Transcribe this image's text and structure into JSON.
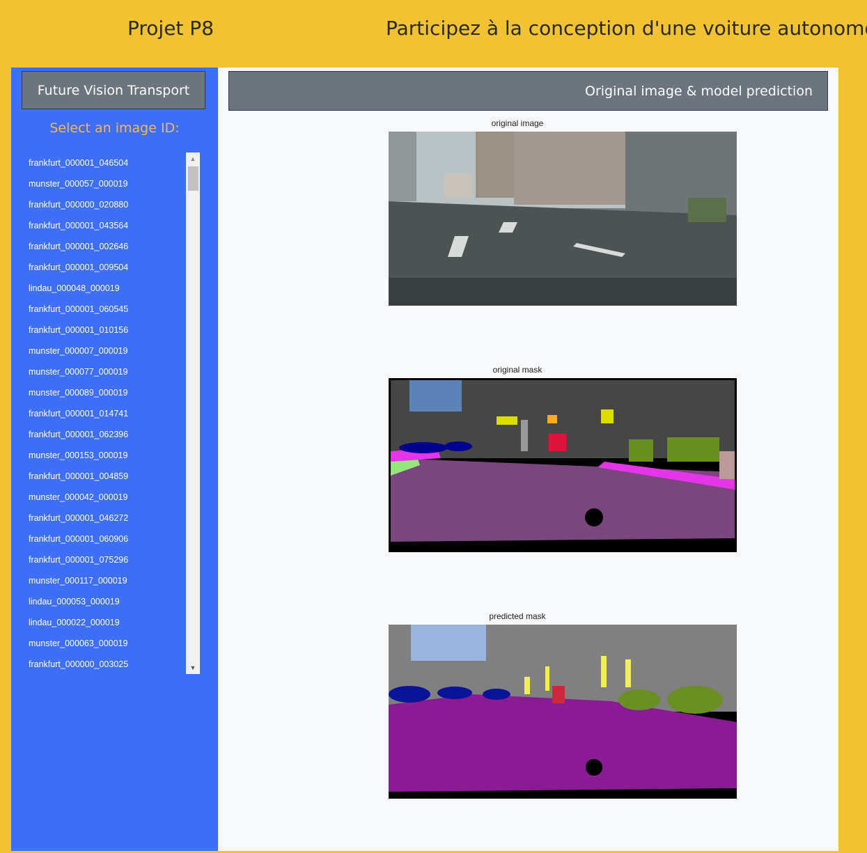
{
  "header": {
    "project_title": "Projet P8",
    "app_title": "Participez à la conception d'une voiture autonome"
  },
  "sidebar": {
    "brand": "Future Vision Transport",
    "select_label": "Select an image ID:",
    "image_ids": [
      "frankfurt_000001_046504",
      "munster_000057_000019",
      "frankfurt_000000_020880",
      "frankfurt_000001_043564",
      "frankfurt_000001_002646",
      "frankfurt_000001_009504",
      "lindau_000048_000019",
      "frankfurt_000001_060545",
      "frankfurt_000001_010156",
      "munster_000007_000019",
      "munster_000077_000019",
      "munster_000089_000019",
      "frankfurt_000001_014741",
      "frankfurt_000001_062396",
      "munster_000153_000019",
      "frankfurt_000001_004859",
      "munster_000042_000019",
      "frankfurt_000001_046272",
      "frankfurt_000001_060906",
      "frankfurt_000001_075296",
      "munster_000117_000019",
      "lindau_000053_000019",
      "lindau_000022_000019",
      "munster_000063_000019",
      "frankfurt_000000_003025"
    ]
  },
  "main": {
    "section_title": "Original image & model prediction",
    "original_image_caption": "original image",
    "original_mask_caption": "original mask",
    "predicted_mask_caption": "predicted mask"
  },
  "colors": {
    "page_background": "#f2c232",
    "sidebar_background": "#3f6ef7",
    "header_box": "#6c757d",
    "select_label": "#f2b75a"
  }
}
